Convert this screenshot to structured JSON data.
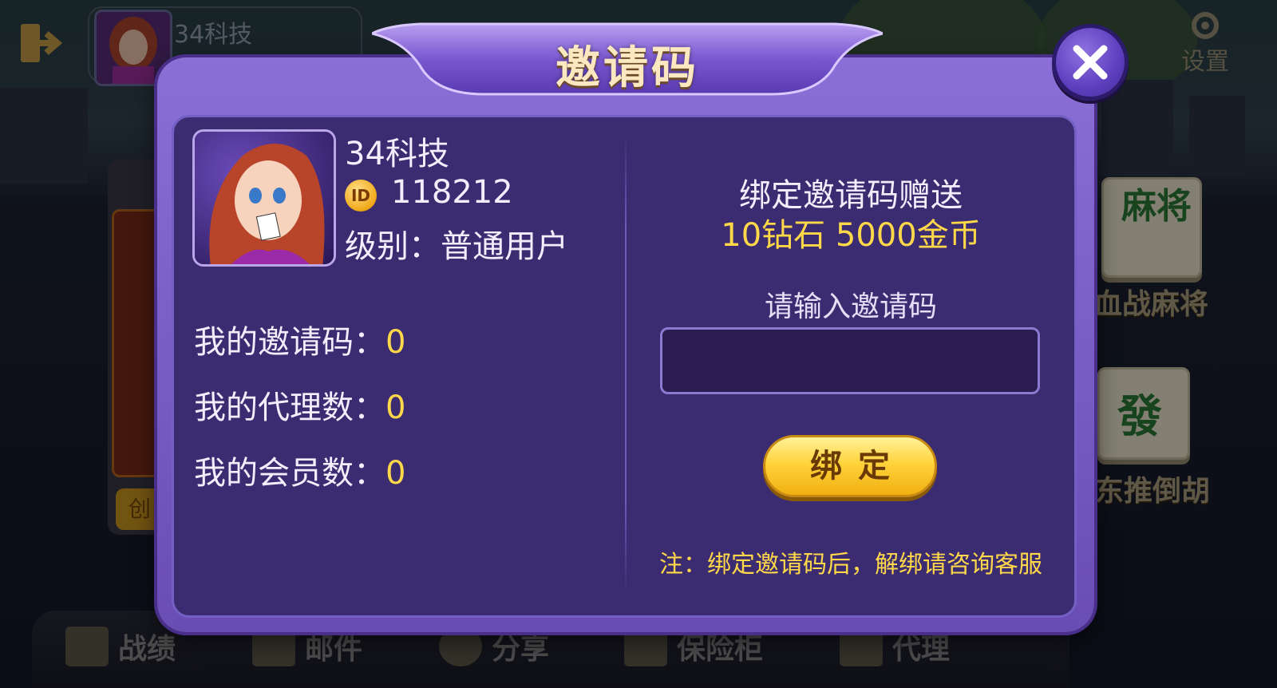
{
  "background": {
    "top_user_name": "34科技",
    "settings_label": "设置",
    "left_panel_button": "创",
    "games": [
      {
        "label": "血战麻将",
        "tile_text": "麻将"
      },
      {
        "label": "东推倒胡",
        "tile_text": "發"
      }
    ],
    "bottom_nav": [
      {
        "label": "战绩",
        "icon": "trophy-icon"
      },
      {
        "label": "邮件",
        "icon": "mail-icon"
      },
      {
        "label": "分享",
        "icon": "share-icon"
      },
      {
        "label": "保险柜",
        "icon": "safe-icon"
      },
      {
        "label": "代理",
        "icon": "agent-icon"
      }
    ]
  },
  "modal": {
    "title": "邀请码",
    "user": {
      "name": "34科技",
      "id_badge": "ID",
      "id": "118212",
      "level": "级别：普通用户"
    },
    "stats": [
      {
        "label": "我的邀请码：",
        "value": "0"
      },
      {
        "label": "我的代理数：",
        "value": "0"
      },
      {
        "label": "我的会员数：",
        "value": "0"
      }
    ],
    "bind": {
      "reward_title": "绑定邀请码赠送",
      "reward_detail": "10钻石 5000金币",
      "input_label": "请输入邀请码",
      "input_value": "",
      "button_label": "绑定",
      "note": "注：绑定邀请码后，解绑请咨询客服"
    }
  },
  "colors": {
    "accent_yellow": "#ffd84a",
    "panel_purple": "#3b2b70",
    "frame_purple": "#7a5ec8"
  }
}
